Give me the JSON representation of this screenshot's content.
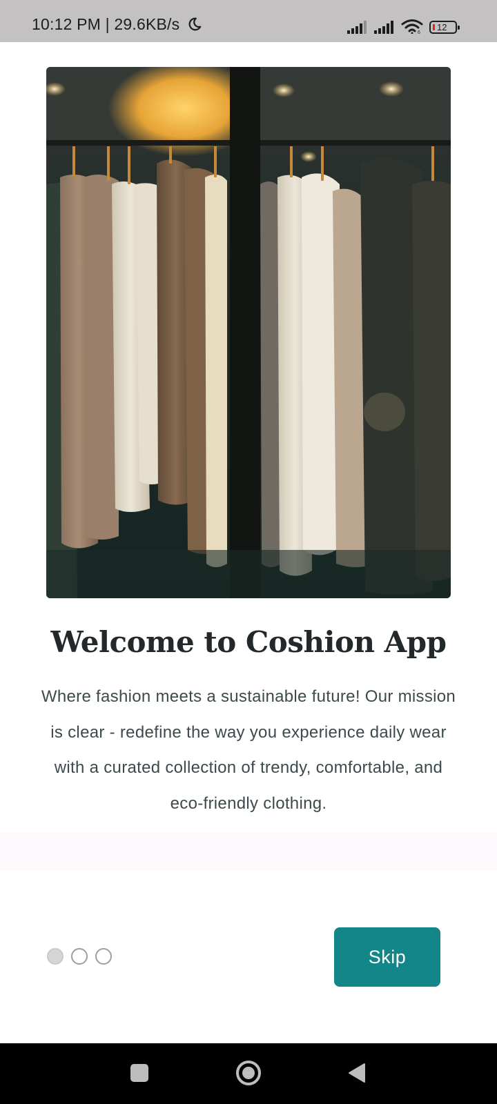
{
  "status_bar": {
    "time_speed": "10:12 PM | 29.6KB/s",
    "battery_level": "12",
    "icons": [
      "moon-icon",
      "signal-icon",
      "signal-icon",
      "wifi-icon",
      "battery-icon"
    ]
  },
  "onboarding": {
    "hero_image": "clothing-rack-image",
    "title": "Welcome to Coshion App",
    "description": "Where fashion meets a sustainable future! Our mission is clear - redefine the way you experience daily wear with a curated collection of trendy, comfortable, and eco-friendly clothing.",
    "pager": {
      "total": 3,
      "active_index": 0
    },
    "skip_label": "Skip"
  },
  "colors": {
    "accent": "#13868a",
    "title_text": "#23282a",
    "body_text": "#3d4a4c",
    "status_bar_bg": "#c3c1c2",
    "nav_bar_bg": "#000000"
  },
  "nav_bar": {
    "icons": [
      "recents-icon",
      "home-icon",
      "back-icon"
    ]
  }
}
